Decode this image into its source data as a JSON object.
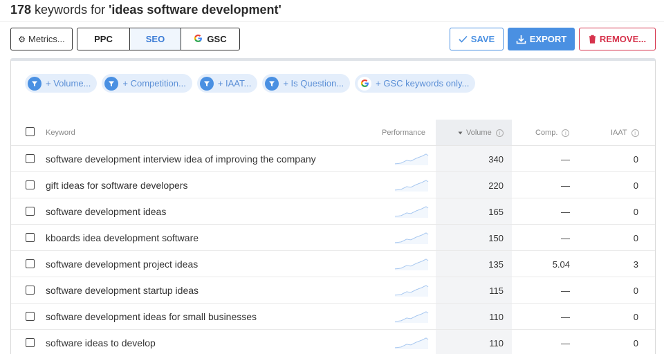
{
  "header": {
    "count": "178",
    "text_mid": " keywords for ",
    "query": "'ideas software development'"
  },
  "toolbar": {
    "metrics_label": "Metrics...",
    "tabs": {
      "ppc": "PPC",
      "seo": "SEO",
      "gsc": "GSC"
    },
    "save_label": "SAVE",
    "export_label": "EXPORT",
    "remove_label": "REMOVE..."
  },
  "filters": [
    {
      "label": "+ Volume...",
      "icon": "filter-icon"
    },
    {
      "label": "+ Competition...",
      "icon": "filter-icon"
    },
    {
      "label": "+ IAAT...",
      "icon": "filter-icon"
    },
    {
      "label": "+ Is Question...",
      "icon": "filter-icon"
    },
    {
      "label": "+ GSC keywords only...",
      "icon": "google-icon"
    }
  ],
  "table": {
    "headers": {
      "keyword": "Keyword",
      "performance": "Performance",
      "volume": "Volume",
      "comp": "Comp.",
      "iaat": "IAAT"
    },
    "sort_indicator": "descending",
    "rows": [
      {
        "keyword": "software development interview idea of improving the company",
        "volume": "340",
        "comp": "—",
        "iaat": "0"
      },
      {
        "keyword": "gift ideas for software developers",
        "volume": "220",
        "comp": "—",
        "iaat": "0"
      },
      {
        "keyword": "software development ideas",
        "volume": "165",
        "comp": "—",
        "iaat": "0"
      },
      {
        "keyword": "kboards idea development software",
        "volume": "150",
        "comp": "—",
        "iaat": "0"
      },
      {
        "keyword": "software development project ideas",
        "volume": "135",
        "comp": "5.04",
        "iaat": "3"
      },
      {
        "keyword": "software development startup ideas",
        "volume": "115",
        "comp": "—",
        "iaat": "0"
      },
      {
        "keyword": "software development ideas for small businesses",
        "volume": "110",
        "comp": "—",
        "iaat": "0"
      },
      {
        "keyword": "software ideas to develop",
        "volume": "110",
        "comp": "—",
        "iaat": "0"
      }
    ]
  },
  "colors": {
    "accent": "#4a90e2",
    "danger": "#d6334c",
    "chip_bg": "#e4eefb",
    "sparkline": "#8fb8ec"
  }
}
